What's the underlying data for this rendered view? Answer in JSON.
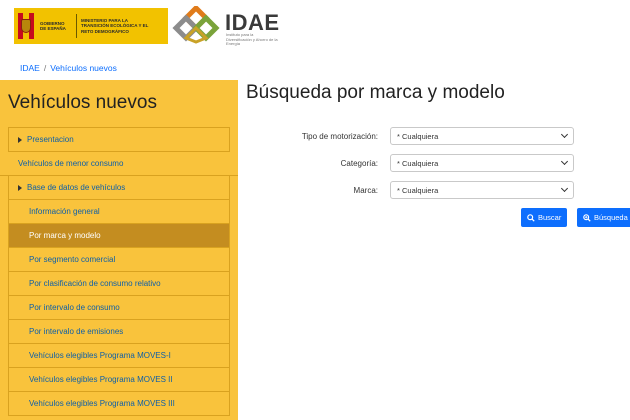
{
  "header": {
    "gov_line1": "GOBIERNO DE ESPAÑA",
    "gov_line2": "MINISTERIO PARA LA TRANSICIÓN ECOLÓGICA Y EL RETO DEMOGRÁFICO",
    "brand": "IDAE",
    "brand_sub": "Instituto para la Diversificación y Ahorro de la Energía",
    "colors": {
      "gov_yellow": "#f2c200",
      "logo_orange": "#e07b1a",
      "logo_green": "#7aa33a",
      "logo_grey": "#8c8c8c"
    }
  },
  "breadcrumb": {
    "home": "IDAE",
    "separator": "/",
    "current": "Vehículos nuevos"
  },
  "sidebar": {
    "title": "Vehículos nuevos",
    "items": [
      {
        "label": "Presentacion",
        "level": "lvl0",
        "arrow": true,
        "active": false
      },
      {
        "label": "Vehículos de menor consumo",
        "level": "plain",
        "arrow": false,
        "active": false
      },
      {
        "label": "Base de datos de vehículos",
        "level": "lvl0",
        "arrow": true,
        "active": false
      },
      {
        "label": "Información general",
        "level": "lvl2",
        "arrow": false,
        "active": false
      },
      {
        "label": "Por marca y modelo",
        "level": "lvl2",
        "arrow": false,
        "active": true
      },
      {
        "label": "Por segmento comercial",
        "level": "lvl2",
        "arrow": false,
        "active": false
      },
      {
        "label": "Por clasificación de consumo relativo",
        "level": "lvl2",
        "arrow": false,
        "active": false
      },
      {
        "label": "Por intervalo de consumo",
        "level": "lvl2",
        "arrow": false,
        "active": false
      },
      {
        "label": "Por intervalo de emisiones",
        "level": "lvl2",
        "arrow": false,
        "active": false
      },
      {
        "label": "Vehículos elegibles Programa MOVES-I",
        "level": "lvl2",
        "arrow": false,
        "active": false
      },
      {
        "label": "Vehículos elegibles Programa MOVES II",
        "level": "lvl2",
        "arrow": false,
        "active": false
      },
      {
        "label": "Vehículos elegibles Programa MOVES III",
        "level": "lvl2",
        "arrow": false,
        "active": false
      }
    ],
    "colors": {
      "background": "#f9c33c",
      "active": "#c48d20",
      "link": "#0d5fa8"
    }
  },
  "main": {
    "title": "Búsqueda por marca y modelo",
    "fields": [
      {
        "label": "Tipo de motorización:",
        "value": "* Cualquiera"
      },
      {
        "label": "Categoría:",
        "value": "* Cualquiera"
      },
      {
        "label": "Marca:",
        "value": "* Cualquiera"
      }
    ],
    "buttons": {
      "search": "Buscar",
      "advanced": "Búsqueda"
    },
    "colors": {
      "button": "#0d6efd"
    }
  }
}
